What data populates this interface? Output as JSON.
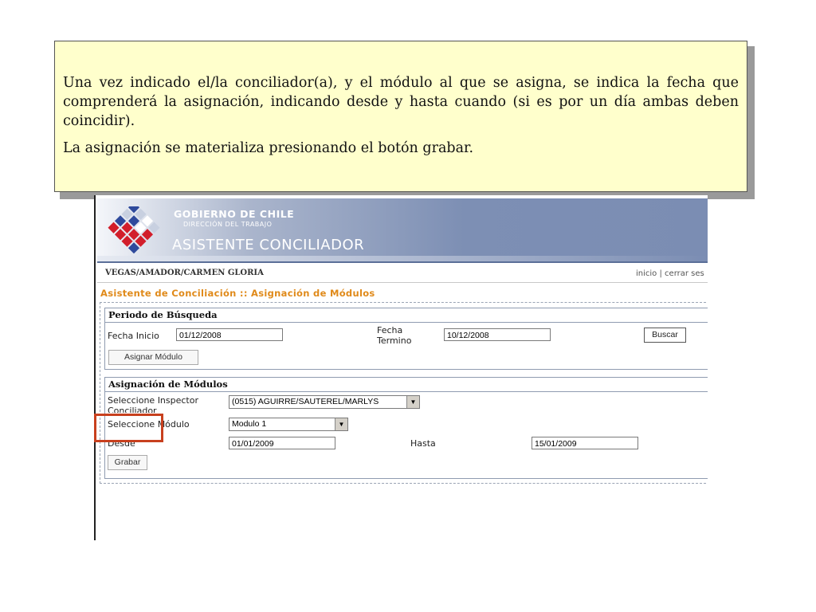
{
  "note": {
    "paragraph1": "Una vez indicado el/la conciliador(a), y el módulo al que se asigna, se indica la fecha que comprenderá la asignación, indicando desde y hasta cuando (si es por un día ambas deben coincidir).",
    "paragraph2": "La asignación se materializa presionando el botón grabar."
  },
  "header": {
    "gobierno": "GOBIERNO DE CHILE",
    "direccion": "DIRECCIÓN DEL TRABAJO",
    "app_title": "ASISTENTE CONCILIADOR"
  },
  "userbar": {
    "user": "VEGAS/AMADOR/CARMEN GLORIA",
    "inicio": "inicio",
    "separator": "|",
    "cerrar": "cerrar ses"
  },
  "breadcrumb": "Asistente de Conciliación :: Asignación de Módulos",
  "periodo": {
    "title": "Periodo de Búsqueda",
    "fecha_inicio_label": "Fecha Inicio",
    "fecha_inicio_value": "01/12/2008",
    "fecha_termino_label_1": "Fecha",
    "fecha_termino_label_2": "Termino",
    "fecha_termino_value": "10/12/2008",
    "buscar": "Buscar",
    "asignar": "Asignar Módulo"
  },
  "asignacion": {
    "title": "Asignación de Módulos",
    "inspector_label_1": "Seleccione Inspector",
    "inspector_label_2": "Conciliador",
    "inspector_value": "(0515) AGUIRRE/SAUTEREL/MARLYS",
    "modulo_label": "Seleccione Módulo",
    "modulo_value": "Modulo 1",
    "desde_label": "Desde",
    "desde_value": "01/01/2009",
    "hasta_label": "Hasta",
    "hasta_value": "15/01/2009",
    "grabar": "Grabar"
  },
  "colors": {
    "note_bg": "#ffffcc",
    "breadcrumb": "#e08a1a",
    "highlight": "#c8401e",
    "banner": "#7b8db3"
  }
}
